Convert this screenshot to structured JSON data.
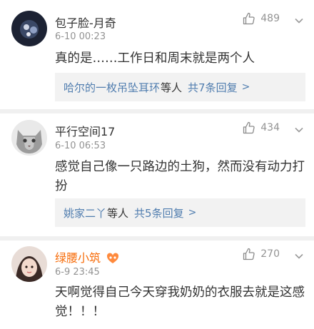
{
  "comments": [
    {
      "user": "包子脸-月奇",
      "time": "6-10 00:23",
      "likes": "489",
      "text": "真的是……工作日和周末就是两个人",
      "reply_names": "哈尔的一枚吊坠耳环",
      "reply_etc": "等人",
      "reply_count": "共7条回复",
      "reply_chevron": ">"
    },
    {
      "user": "平行空间17",
      "time": "6-10 06:53",
      "likes": "434",
      "text": "感觉自己像一只路边的土狗，然而没有动力打扮",
      "reply_names": "姚家二丫",
      "reply_etc": "等人",
      "reply_count": "共5条回复",
      "reply_chevron": ">"
    },
    {
      "user": "绿腰小筑",
      "time": "6-9 23:45",
      "likes": "270",
      "text": "天啊觉得自己今天穿我奶奶的衣服去就是这感觉！！！"
    }
  ],
  "colors": {
    "link": "#507daf",
    "vip_name": "#f76d0b",
    "meta": "#939393"
  },
  "icons": [
    "thumbs-up-icon",
    "chevron-down-icon",
    "vip-badge-icon"
  ]
}
